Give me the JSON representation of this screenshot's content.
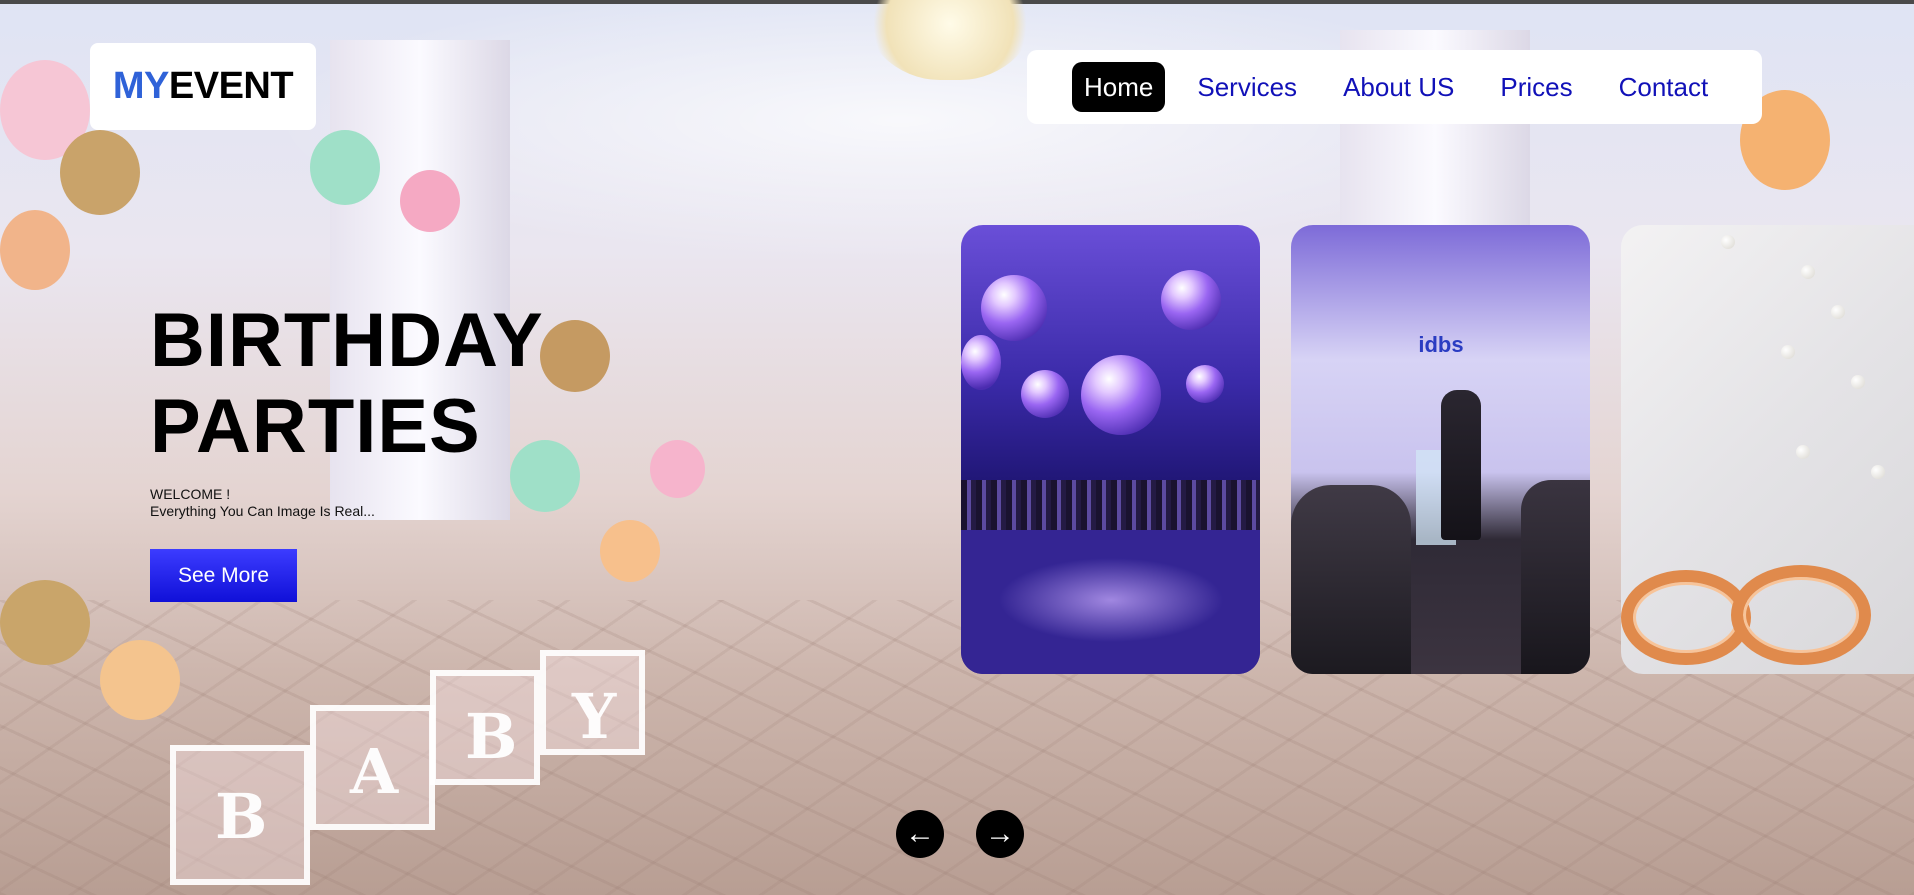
{
  "brand": {
    "part1": "MY",
    "part2": "EVENT"
  },
  "nav": {
    "items": [
      {
        "label": "Home",
        "active": true
      },
      {
        "label": "Services",
        "active": false
      },
      {
        "label": "About US",
        "active": false
      },
      {
        "label": "Prices",
        "active": false
      },
      {
        "label": "Contact",
        "active": false
      }
    ]
  },
  "hero": {
    "title_line1": "BIRTHDAY",
    "title_line2": "PARTIES",
    "welcome": "WELCOME !",
    "tagline": "Everything You Can Image Is Real...",
    "button_label": "See More"
  },
  "slider": {
    "cards": [
      {
        "subject": "nightclub-party-photo"
      },
      {
        "subject": "conference-speaker-photo",
        "screen_text": "idbs"
      },
      {
        "subject": "wedding-rings-photo"
      }
    ],
    "prev_icon": "arrow-left-icon",
    "next_icon": "arrow-right-icon"
  },
  "colors": {
    "brand_blue": "#2f62d8",
    "nav_link": "#1111b8",
    "nav_active_bg": "#000000",
    "button_blue": "#1a1aee"
  }
}
